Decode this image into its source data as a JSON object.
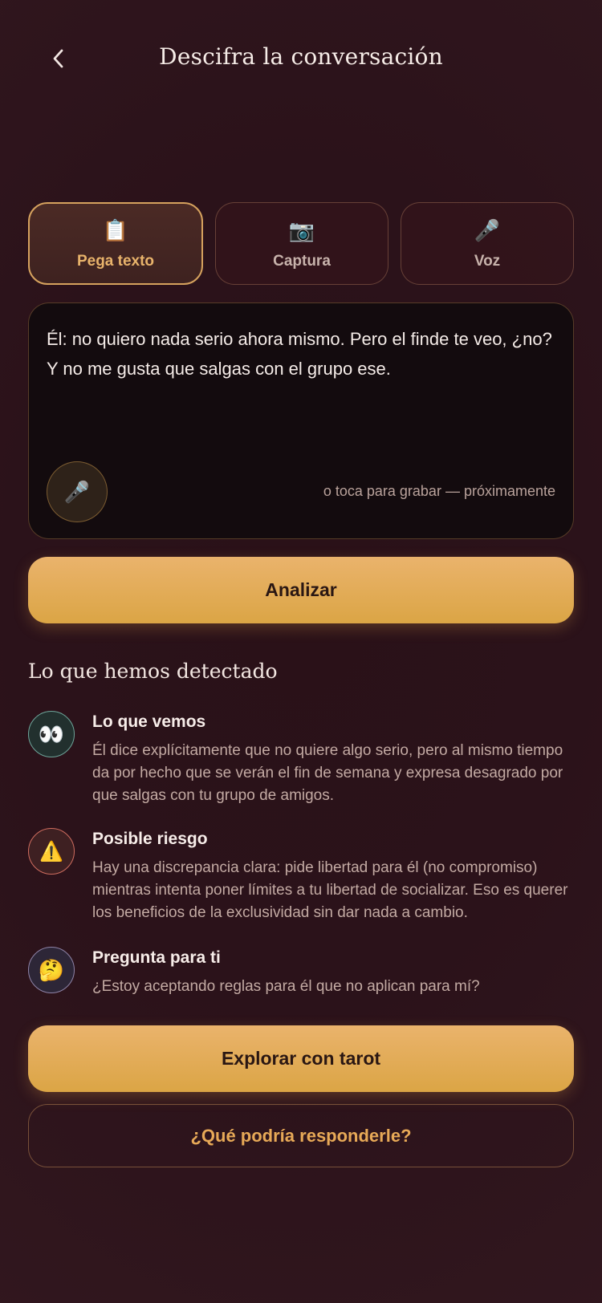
{
  "header": {
    "title": "Descifra la conversación",
    "back_icon": "chevron-left-icon"
  },
  "tabs": [
    {
      "label": "Pega texto",
      "icon": "📋",
      "active": true
    },
    {
      "label": "Captura",
      "icon": "📷",
      "active": false
    },
    {
      "label": "Voz",
      "icon": "🎤",
      "active": false
    }
  ],
  "input": {
    "text": "Él: no quiero nada serio ahora mismo. Pero el finde te veo, ¿no? Y no me gusta que salgas con el grupo ese.",
    "record_hint": "o toca para grabar — próximamente",
    "mic_icon": "🎤"
  },
  "analyze_label": "Analizar",
  "detected": {
    "title": "Lo que hemos detectado",
    "items": [
      {
        "icon": "👀",
        "title": "Lo que vemos",
        "text": "Él dice explícitamente que no quiere algo serio, pero al mismo tiempo da por hecho que se verán el fin de semana y expresa desagrado por que salgas con tu grupo de amigos."
      },
      {
        "icon": "⚠️",
        "title": "Posible riesgo",
        "text": "Hay una discrepancia clara: pide libertad para él (no compromiso) mientras intenta poner límites a tu libertad de socializar. Eso es querer los beneficios de la exclusividad sin dar nada a cambio."
      },
      {
        "icon": "🤔",
        "title": "Pregunta para ti",
        "text": "¿Estoy aceptando reglas para él que no aplican para mí?"
      }
    ]
  },
  "actions": {
    "tarot_label": "Explorar con tarot",
    "reply_label": "¿Qué podría responderle?"
  },
  "colors": {
    "accent": "#e8b36b",
    "background": "#2b1219",
    "button": "#dba545"
  }
}
